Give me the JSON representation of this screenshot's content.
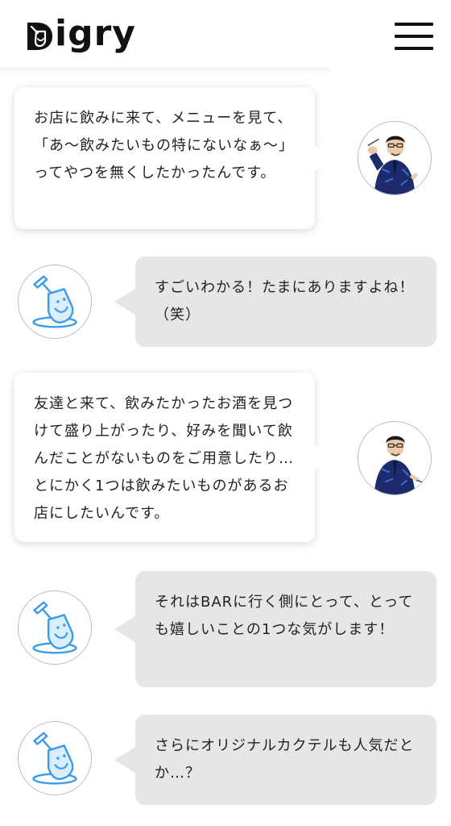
{
  "header": {
    "logo_text": "igry",
    "logo_icon": "shovel-d-logo-icon",
    "menu_icon": "hamburger-menu-icon"
  },
  "colors": {
    "accent_blue": "#3d9be9",
    "bubble_gray": "#e6e6e6",
    "bubble_white": "#ffffff",
    "text": "#222222"
  },
  "messages": [
    {
      "speaker": "person",
      "text": "お店に飲みに来て、メニューを見て、「あ〜飲みたいもの特にないなぁ〜」ってやつを無くしたかったんです。"
    },
    {
      "speaker": "digry",
      "text": "すごいわかる！たまにありますよね！（笑）"
    },
    {
      "speaker": "person",
      "text": "友達と来て、飲みたかったお酒を見つけて盛り上がったり、好みを聞いて飲んだことがないものをご用意したり…とにかく1つは飲みたいものがあるお店にしたいんです。"
    },
    {
      "speaker": "digry",
      "text": "それはBARに行く側にとって、とっても嬉しいことの1つな気がします！"
    },
    {
      "speaker": "digry",
      "text": "さらにオリジナルカクテルも人気だとか…？"
    }
  ]
}
